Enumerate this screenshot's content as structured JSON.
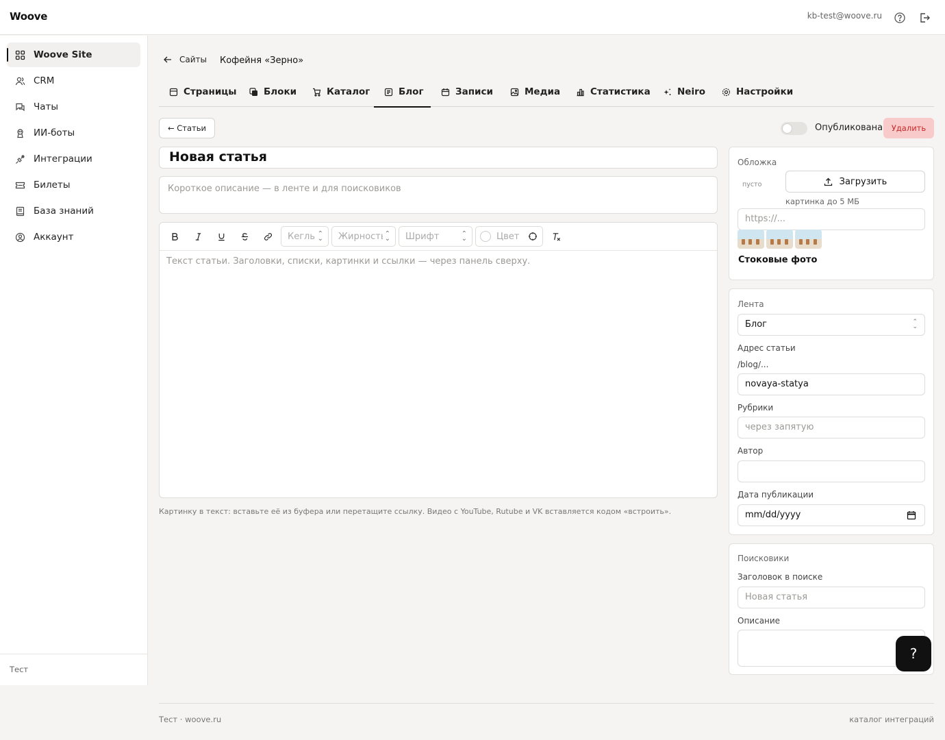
{
  "app": {
    "logo": "Woove",
    "user_email": "kb-test@woove.ru"
  },
  "sidebar": {
    "items": [
      {
        "label": "Woove Site",
        "icon": "grid-icon",
        "active": true
      },
      {
        "label": "CRM",
        "icon": "users-icon"
      },
      {
        "label": "Чаты",
        "icon": "chat-icon"
      },
      {
        "label": "ИИ-боты",
        "icon": "bot-icon"
      },
      {
        "label": "Интеграции",
        "icon": "plug-icon"
      },
      {
        "label": "Билеты",
        "icon": "ticket-icon"
      },
      {
        "label": "База знаний",
        "icon": "book-icon"
      },
      {
        "label": "Аккаунт",
        "icon": "account-icon"
      }
    ],
    "footer": "Тест"
  },
  "breadcrumb": {
    "back_label": "Сайты",
    "site_name": "Кофейня «Зерно»"
  },
  "tabs": [
    {
      "label": "Страницы",
      "icon": "page-icon"
    },
    {
      "label": "Блоки",
      "icon": "blocks-icon"
    },
    {
      "label": "Каталог",
      "icon": "cart-icon"
    },
    {
      "label": "Блог",
      "icon": "blog-icon",
      "active": true
    },
    {
      "label": "Записи",
      "icon": "calendar-icon"
    },
    {
      "label": "Медиа",
      "icon": "image-icon"
    },
    {
      "label": "Статистика",
      "icon": "chart-icon"
    },
    {
      "label": "Neiro",
      "icon": "sparkle-icon"
    },
    {
      "label": "Настройки",
      "icon": "gear-icon"
    }
  ],
  "article": {
    "back_button": "← Статьи",
    "published_label": "Опубликована",
    "published": false,
    "delete_button": "Удалить",
    "title": "Новая статья",
    "description_placeholder": "Короткое описание — в ленте и для поисковиков",
    "body_placeholder": "Текст статьи. Заголовки, списки, картинки и ссылки — через панель сверху.",
    "hint": "Картинку в текст: вставьте её из буфера или перетащите ссылку. Видео с YouTube, Rutube и VK вставляется кодом «встроить»."
  },
  "toolbar": {
    "size_placeholder": "Кегль",
    "weight_placeholder": "Жирность",
    "font_placeholder": "Шрифт",
    "color_placeholder": "Цвет"
  },
  "cover": {
    "label": "Обложка",
    "empty": "пусто",
    "upload_button": "Загрузить",
    "size_hint": "картинка до 5 МБ",
    "url_placeholder": "https://...",
    "stock_label": "Стоковые фото"
  },
  "settings": {
    "feed_label": "Лента",
    "feed_value": "Блог",
    "slug_label": "Адрес статьи",
    "slug_prefix": "/blog/...",
    "slug_value": "novaya-statya",
    "rubrics_label": "Рубрики",
    "rubrics_placeholder": "через запятую",
    "author_label": "Автор",
    "author_value": "",
    "date_label": "Дата публикации",
    "date_placeholder": "mm/dd/yyyy"
  },
  "seo": {
    "section_label": "Поисковики",
    "title_label": "Заголовок в поиске",
    "title_placeholder": "Новая статья",
    "desc_label": "Описание"
  },
  "help_button": "?",
  "footer": {
    "left": "Тест · woove.ru",
    "right": "каталог интеграций"
  }
}
